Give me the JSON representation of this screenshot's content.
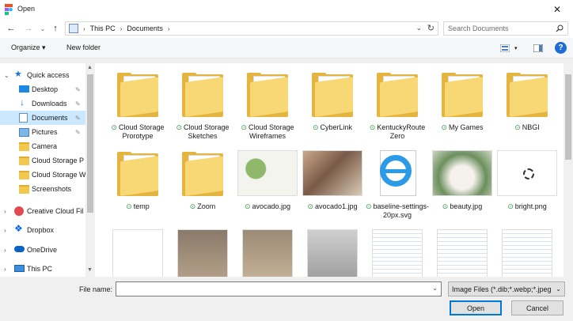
{
  "window": {
    "title": "Open",
    "close_glyph": "✕"
  },
  "nav": {
    "back_glyph": "←",
    "forward_glyph": "→",
    "recent_glyph": "⌄",
    "up_glyph": "↑",
    "breadcrumbs": [
      "This PC",
      "Documents"
    ],
    "search_placeholder": "Search Documents"
  },
  "toolbar": {
    "organize_label": "Organize ▾",
    "new_folder_label": "New folder",
    "help_glyph": "?"
  },
  "sidebar": {
    "items": [
      {
        "label": "Quick access",
        "icon": "star-icon"
      },
      {
        "label": "Desktop",
        "icon": "desktop-icon"
      },
      {
        "label": "Downloads",
        "icon": "download-icon"
      },
      {
        "label": "Documents",
        "icon": "documents-icon"
      },
      {
        "label": "Pictures",
        "icon": "pictures-icon"
      },
      {
        "label": "Camera",
        "icon": "folder-icon"
      },
      {
        "label": "Cloud Storage P",
        "icon": "folder-icon"
      },
      {
        "label": "Cloud Storage W",
        "icon": "folder-icon"
      },
      {
        "label": "Screenshots",
        "icon": "folder-icon"
      },
      {
        "label": "Creative Cloud Fil",
        "icon": "creative-cloud-icon"
      },
      {
        "label": "Dropbox",
        "icon": "dropbox-icon"
      },
      {
        "label": "OneDrive",
        "icon": "onedrive-icon"
      },
      {
        "label": "This PC",
        "icon": "computer-icon"
      }
    ],
    "selected": "Documents"
  },
  "files": [
    {
      "name": "Cloud Storage Prorotype",
      "kind": "folder",
      "synced": true
    },
    {
      "name": "Cloud Storage Sketches",
      "kind": "folder",
      "synced": true
    },
    {
      "name": "Cloud Storage Wireframes",
      "kind": "folder",
      "synced": true
    },
    {
      "name": "CyberLink",
      "kind": "folder",
      "synced": true
    },
    {
      "name": "KentuckyRoute Zero",
      "kind": "folder",
      "synced": true
    },
    {
      "name": "My Games",
      "kind": "folder",
      "synced": true
    },
    {
      "name": "NBGI",
      "kind": "folder",
      "synced": true
    },
    {
      "name": "temp",
      "kind": "folder",
      "synced": true
    },
    {
      "name": "Zoom",
      "kind": "folder",
      "synced": true
    },
    {
      "name": "avocado.jpg",
      "kind": "image",
      "synced": true
    },
    {
      "name": "avocado1.jpg",
      "kind": "image",
      "synced": true
    },
    {
      "name": "baseline-settings-20px.svg",
      "kind": "browser-file",
      "synced": true
    },
    {
      "name": "beauty.jpg",
      "kind": "image",
      "synced": true
    },
    {
      "name": "bright.png",
      "kind": "image",
      "synced": true
    }
  ],
  "bottom": {
    "filename_label": "File name:",
    "filename_value": "",
    "filter_label": "Image Files (*.dib;*.webp;*.jpeg",
    "open_label": "Open",
    "cancel_label": "Cancel"
  },
  "colors": {
    "accent": "#0078d7",
    "selected_bg": "#cce8ff",
    "sync_green": "#2e9a3c",
    "folder": "#f8d775"
  }
}
